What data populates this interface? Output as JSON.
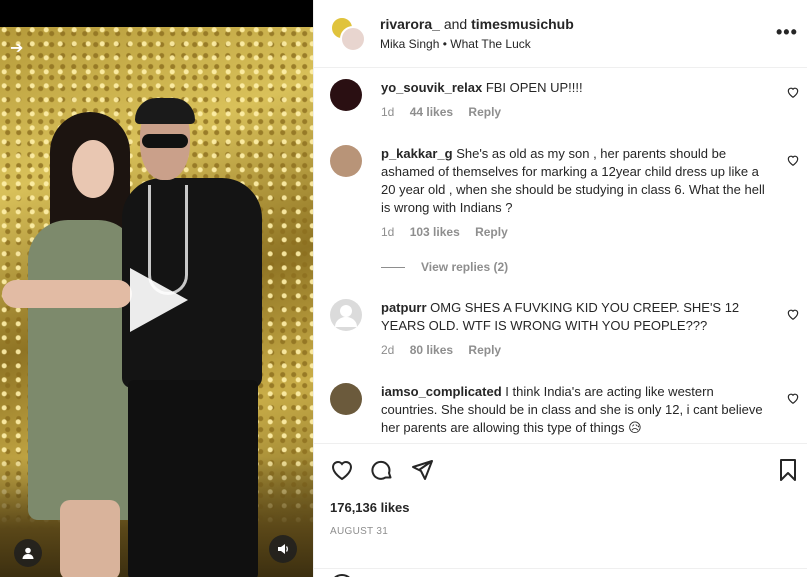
{
  "post": {
    "author1": "rivarora_",
    "and_text": "and",
    "author2": "timesmusichub",
    "music_artist": "Mika Singh",
    "music_separator": "•",
    "music_title": "What The Luck"
  },
  "video": {
    "user_icon": "user-icon",
    "sound_icon": "sound-icon",
    "play_icon": "play-icon"
  },
  "comments": [
    {
      "username": "yo_souvik_relax",
      "text": "FBI OPEN UP!!!!",
      "time": "1d",
      "likes": "44 likes",
      "reply": "Reply",
      "avatar_color": "#2a0f12"
    },
    {
      "username": "p_kakkar_g",
      "text": "She's as old as my son , her parents should be ashamed of themselves for marking a 12year child dress up like a 20 year old , when she should be studying in class 6. What the hell is wrong with Indians ?",
      "time": "1d",
      "likes": "103 likes",
      "reply": "Reply",
      "avatar_color": "#b89478",
      "view_replies": "View replies (2)"
    },
    {
      "username": "patpurr",
      "text": "OMG SHES A FUVKING KID YOU CREEP. SHE'S 12 YEARS OLD. WTF IS WRONG WITH YOU PEOPLE???",
      "time": "2d",
      "likes": "80 likes",
      "reply": "Reply",
      "avatar_color": "#dbdbdb"
    },
    {
      "username": "iamso_complicated",
      "text": "I think India's are acting like western countries. She should be in class and she is only 12, i cant believe her parents are allowing this type of things 😥",
      "time": "",
      "likes": "",
      "reply": "",
      "avatar_color": "#6b5a3c"
    }
  ],
  "actions": {
    "likes": "176,136 likes",
    "date": "AUGUST 31"
  },
  "colors": {
    "text": "#262626",
    "muted": "#8e8e8e",
    "divider": "#efefef"
  }
}
